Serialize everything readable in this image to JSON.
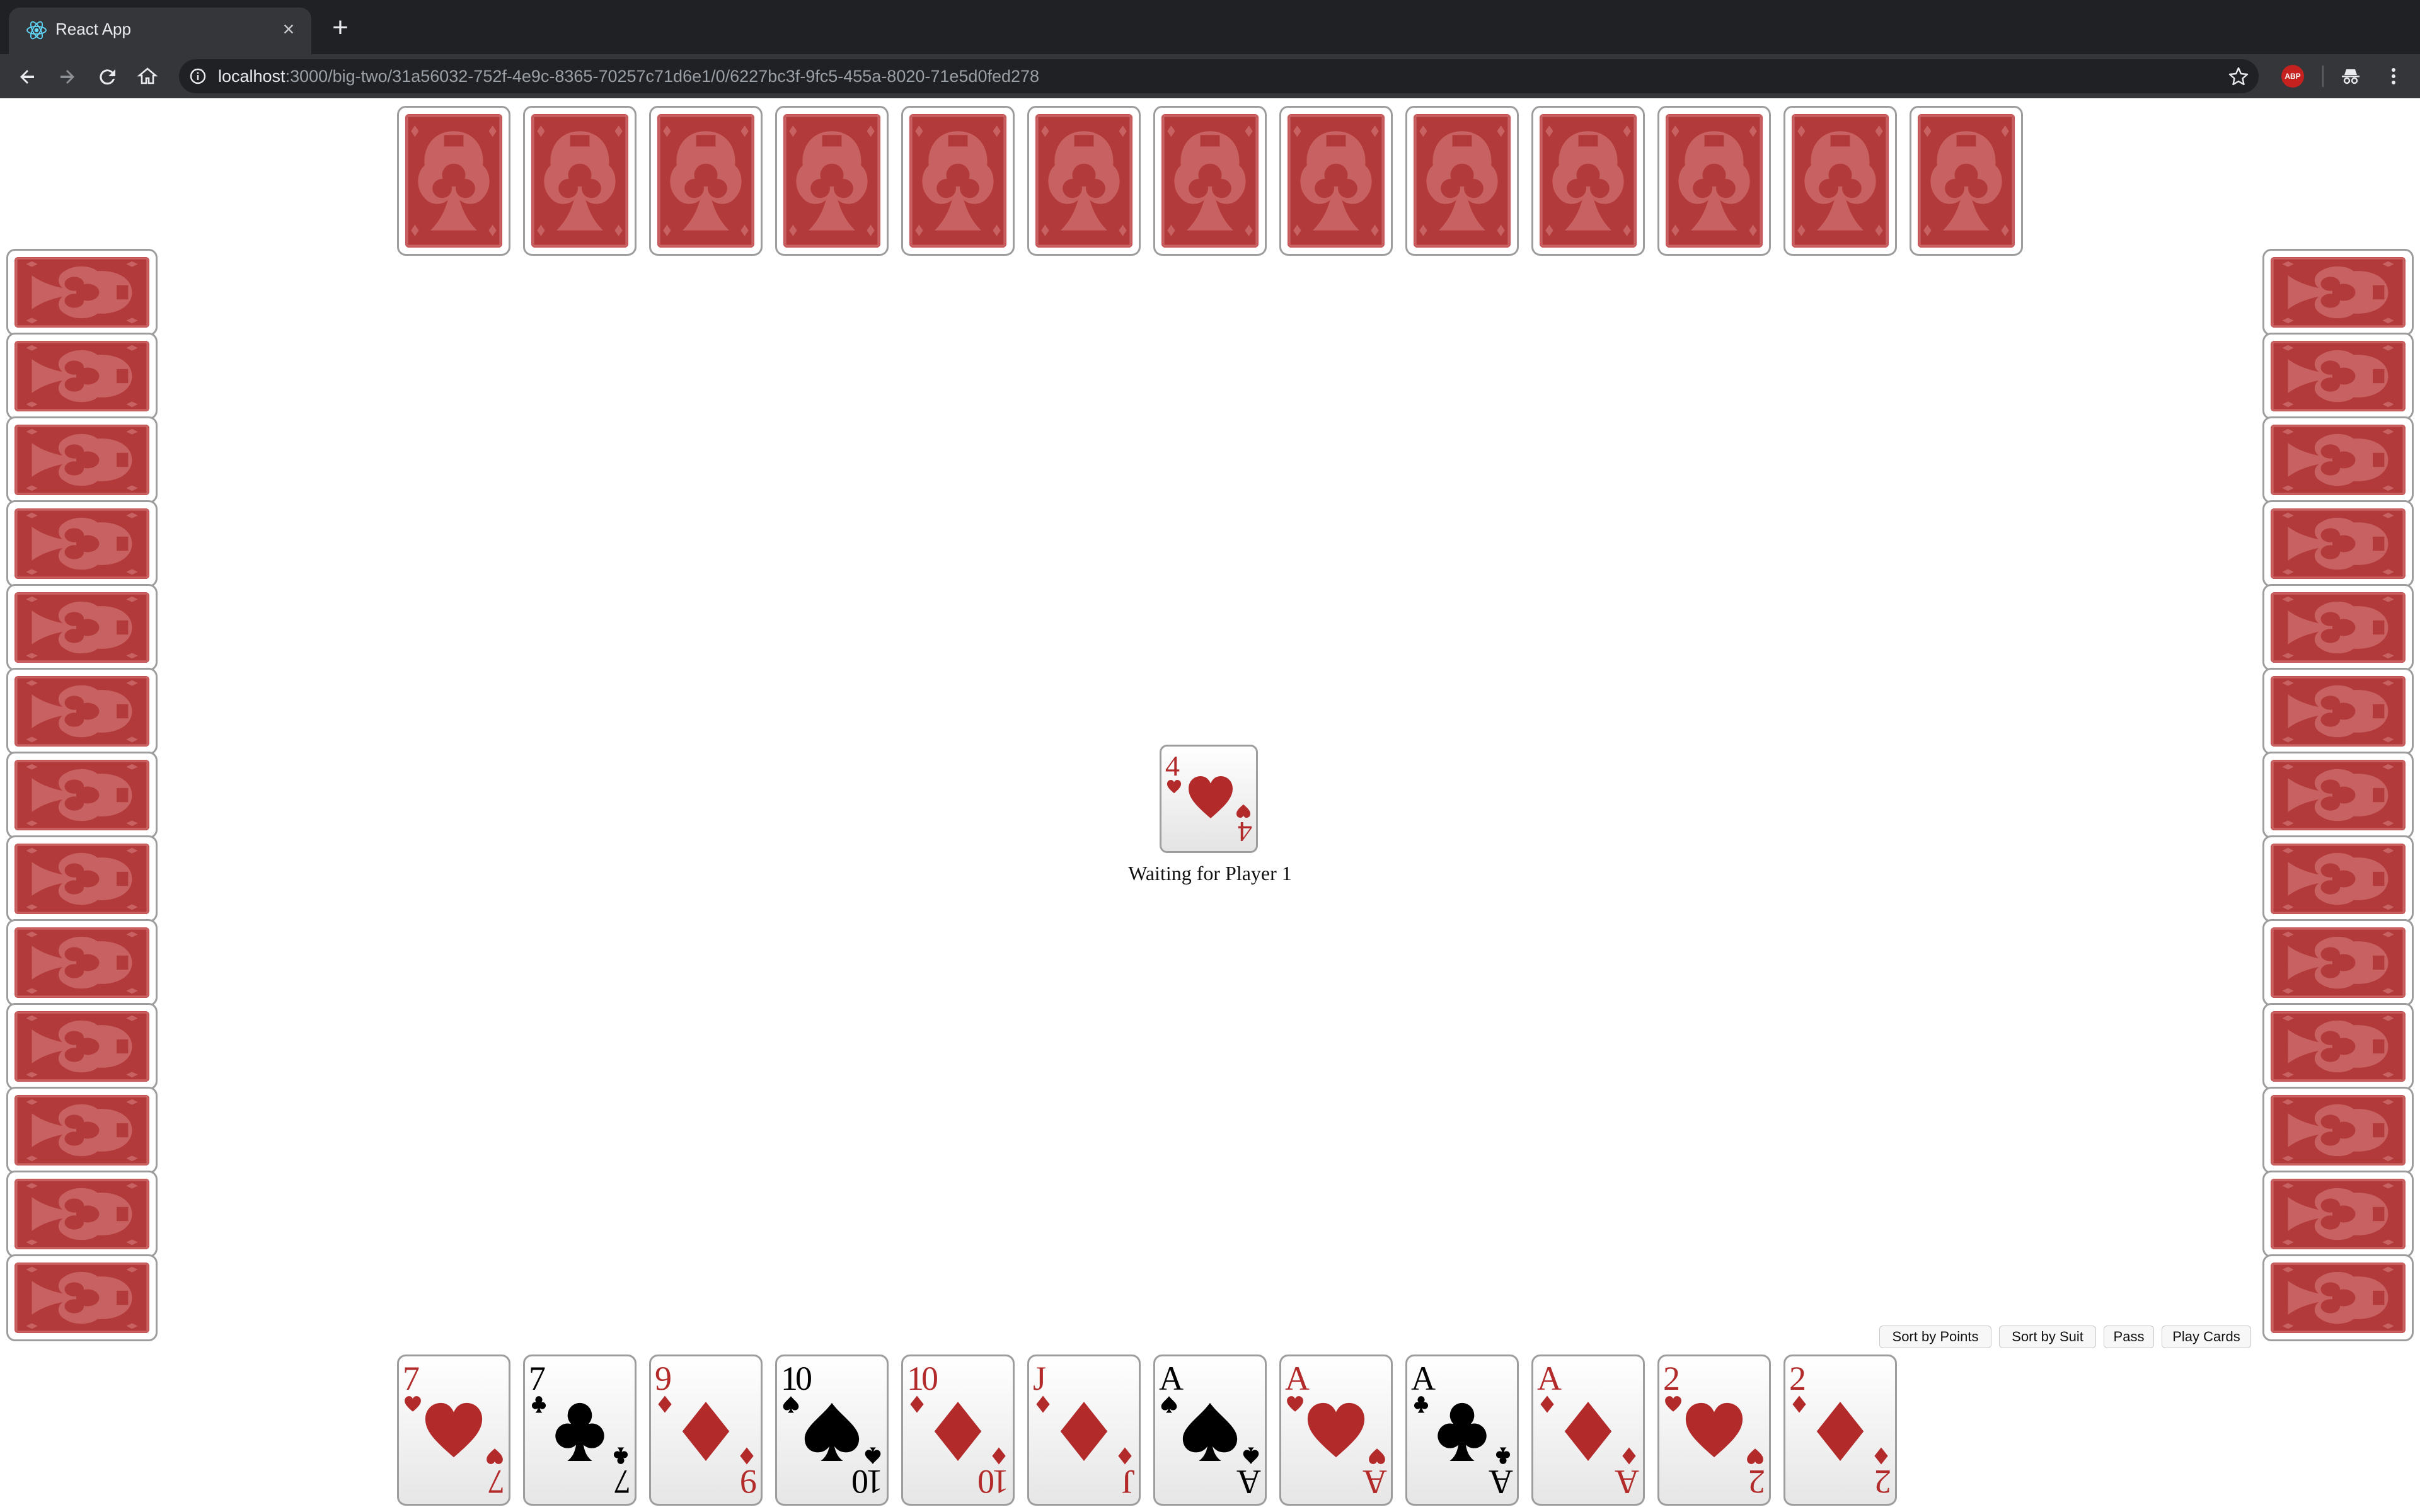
{
  "browser": {
    "tab_title": "React App",
    "url_host": "localhost",
    "url_path": ":3000/big-two/31a56032-752f-4e9c-8365-70257c71d6e1/0/6227bc3f-9fc5-455a-8020-71e5d0fed278",
    "extension_badge": "ABP"
  },
  "opponents": {
    "top": {
      "card_count": 13
    },
    "left": {
      "card_count": 13
    },
    "right": {
      "card_count": 13
    }
  },
  "table": {
    "last_played": [
      {
        "rank": "4",
        "suit": "hearts",
        "color": "red"
      }
    ],
    "status_text": "Waiting for Player 1"
  },
  "controls": {
    "sort_by_points": "Sort by Points",
    "sort_by_suit": "Sort by Suit",
    "pass": "Pass",
    "play_cards": "Play Cards"
  },
  "hand": [
    {
      "rank": "7",
      "suit": "hearts",
      "color": "red"
    },
    {
      "rank": "7",
      "suit": "clubs",
      "color": "black"
    },
    {
      "rank": "9",
      "suit": "diamonds",
      "color": "red"
    },
    {
      "rank": "10",
      "suit": "spades",
      "color": "black"
    },
    {
      "rank": "10",
      "suit": "diamonds",
      "color": "red"
    },
    {
      "rank": "J",
      "suit": "diamonds",
      "color": "red"
    },
    {
      "rank": "A",
      "suit": "spades",
      "color": "black"
    },
    {
      "rank": "A",
      "suit": "hearts",
      "color": "red"
    },
    {
      "rank": "A",
      "suit": "clubs",
      "color": "black"
    },
    {
      "rank": "A",
      "suit": "diamonds",
      "color": "red"
    },
    {
      "rank": "2",
      "suit": "hearts",
      "color": "red"
    },
    {
      "rank": "2",
      "suit": "diamonds",
      "color": "red"
    }
  ],
  "colors": {
    "card_back": "#b33a3a",
    "red_suit": "#b22a2a",
    "chrome_dark": "#202124",
    "chrome_toolbar": "#35363a"
  }
}
